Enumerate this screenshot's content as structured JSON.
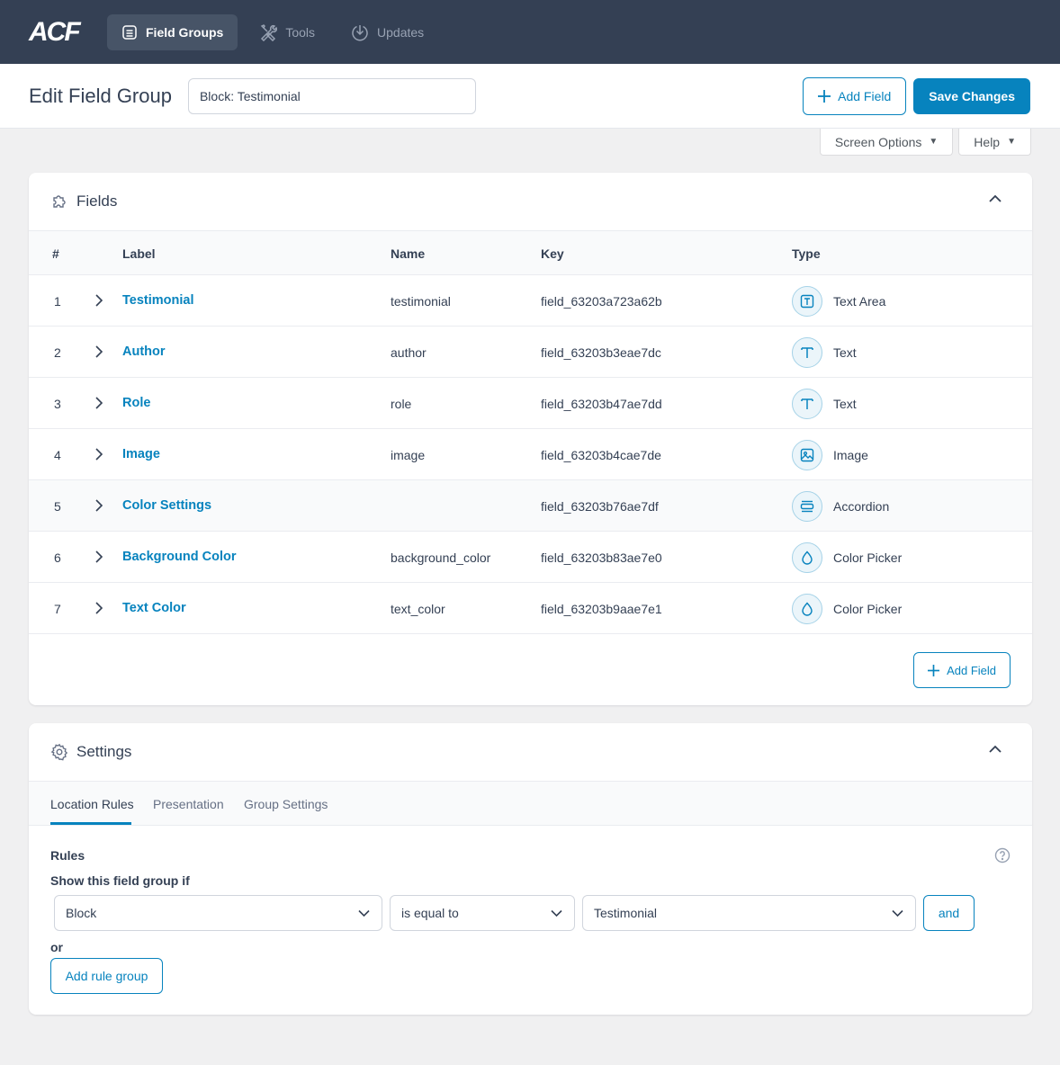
{
  "nav": {
    "logo": "ACF",
    "tabs": [
      {
        "label": "Field Groups",
        "icon": "list-icon",
        "active": true
      },
      {
        "label": "Tools",
        "icon": "tools-icon",
        "active": false
      },
      {
        "label": "Updates",
        "icon": "download-icon",
        "active": false
      }
    ]
  },
  "header": {
    "title": "Edit Field Group",
    "group_name": "Block: Testimonial",
    "add_field_label": "Add Field",
    "save_label": "Save Changes"
  },
  "screen_meta": {
    "screen_options": "Screen Options",
    "help": "Help"
  },
  "fields_panel": {
    "title": "Fields",
    "columns": {
      "num": "#",
      "label": "Label",
      "name": "Name",
      "key": "Key",
      "type": "Type"
    },
    "rows": [
      {
        "num": "1",
        "label": "Testimonial",
        "name": "testimonial",
        "key": "field_63203a723a62b",
        "type": "Text Area",
        "icon": "textarea-icon"
      },
      {
        "num": "2",
        "label": "Author",
        "name": "author",
        "key": "field_63203b3eae7dc",
        "type": "Text",
        "icon": "text-icon"
      },
      {
        "num": "3",
        "label": "Role",
        "name": "role",
        "key": "field_63203b47ae7dd",
        "type": "Text",
        "icon": "text-icon"
      },
      {
        "num": "4",
        "label": "Image",
        "name": "image",
        "key": "field_63203b4cae7de",
        "type": "Image",
        "icon": "image-icon"
      },
      {
        "num": "5",
        "label": "Color Settings",
        "name": "",
        "key": "field_63203b76ae7df",
        "type": "Accordion",
        "icon": "accordion-icon"
      },
      {
        "num": "6",
        "label": "Background Color",
        "name": "background_color",
        "key": "field_63203b83ae7e0",
        "type": "Color Picker",
        "icon": "droplet-icon"
      },
      {
        "num": "7",
        "label": "Text Color",
        "name": "text_color",
        "key": "field_63203b9aae7e1",
        "type": "Color Picker",
        "icon": "droplet-icon"
      }
    ],
    "add_field_label": "Add Field"
  },
  "settings_panel": {
    "title": "Settings",
    "tabs": [
      "Location Rules",
      "Presentation",
      "Group Settings"
    ],
    "rules_heading": "Rules",
    "show_if": "Show this field group if",
    "rule": {
      "param": "Block",
      "operator": "is equal to",
      "value": "Testimonial"
    },
    "and_label": "and",
    "or_label": "or",
    "add_rule_group_label": "Add rule group"
  },
  "colors": {
    "accent": "#0783be",
    "nav_bg": "#344054"
  }
}
